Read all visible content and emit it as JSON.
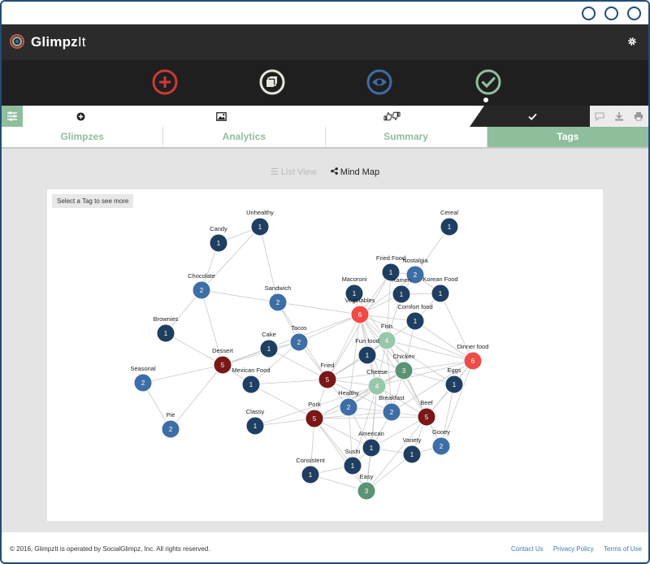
{
  "app": {
    "brand_bold": "Glimpz",
    "brand_rest": "It"
  },
  "toolbar": {
    "active_tool": "check"
  },
  "tabs": [
    {
      "label": "Glimpzes",
      "active": false
    },
    {
      "label": "Analytics",
      "active": false
    },
    {
      "label": "Summary",
      "active": false
    },
    {
      "label": "Tags",
      "active": true
    }
  ],
  "view_toggle": {
    "list_label": "List View",
    "mind_label": "Mind Map"
  },
  "hint": "Select a Tag to see more",
  "colors": {
    "navy": "#1e3f61",
    "blue": "#3d6ea6",
    "darkred": "#7a1717",
    "red": "#ef4b47",
    "mint": "#97c8aa",
    "green": "#5b9374"
  },
  "mind_map": {
    "nodes": [
      {
        "id": "unhealthy",
        "label": "Unhealthy",
        "count": "1",
        "color": "navy"
      },
      {
        "id": "candy",
        "label": "Candy",
        "count": "1",
        "color": "navy"
      },
      {
        "id": "chocolate",
        "label": "Chocolate",
        "count": "2",
        "color": "blue"
      },
      {
        "id": "sandwich",
        "label": "Sandwich",
        "count": "2",
        "color": "blue"
      },
      {
        "id": "brownies",
        "label": "Brownies",
        "count": "1",
        "color": "navy"
      },
      {
        "id": "cake",
        "label": "Cake",
        "count": "1",
        "color": "navy"
      },
      {
        "id": "tacos",
        "label": "Tacos",
        "count": "2",
        "color": "blue"
      },
      {
        "id": "dessert",
        "label": "Dessert",
        "count": "5",
        "color": "darkred"
      },
      {
        "id": "seasonal",
        "label": "Seasonal",
        "count": "2",
        "color": "blue"
      },
      {
        "id": "mexican",
        "label": "Mexican Food",
        "count": "1",
        "color": "navy"
      },
      {
        "id": "pie",
        "label": "Pie",
        "count": "2",
        "color": "blue"
      },
      {
        "id": "classy",
        "label": "Classy",
        "count": "1",
        "color": "navy"
      },
      {
        "id": "fried",
        "label": "Fried",
        "count": "5",
        "color": "darkred"
      },
      {
        "id": "pork",
        "label": "Pork",
        "count": "5",
        "color": "darkred"
      },
      {
        "id": "consistent",
        "label": "Consistent",
        "count": "1",
        "color": "navy"
      },
      {
        "id": "cereal",
        "label": "Cereal",
        "count": "1",
        "color": "navy"
      },
      {
        "id": "friedfood",
        "label": "Fried Food",
        "count": "1",
        "color": "navy"
      },
      {
        "id": "nostalgia",
        "label": "Nostalgia",
        "count": "2",
        "color": "blue"
      },
      {
        "id": "macoroni",
        "label": "Macoroni",
        "count": "1",
        "color": "navy"
      },
      {
        "id": "ramen",
        "label": "Ramen",
        "count": "1",
        "color": "navy"
      },
      {
        "id": "korean",
        "label": "Korean Food",
        "count": "1",
        "color": "navy"
      },
      {
        "id": "vegetables",
        "label": "Vegetables",
        "count": "6",
        "color": "red"
      },
      {
        "id": "comfort",
        "label": "Comfort food",
        "count": "1",
        "color": "navy"
      },
      {
        "id": "fish",
        "label": "Fish",
        "count": "4",
        "color": "mint"
      },
      {
        "id": "funfood",
        "label": "Fun food",
        "count": "1",
        "color": "navy"
      },
      {
        "id": "chicken",
        "label": "Chicken",
        "count": "3",
        "color": "green"
      },
      {
        "id": "dinner",
        "label": "Dinner food",
        "count": "6",
        "color": "red"
      },
      {
        "id": "eggs",
        "label": "Eggs",
        "count": "1",
        "color": "navy"
      },
      {
        "id": "cheese",
        "label": "Cheese",
        "count": "4",
        "color": "mint"
      },
      {
        "id": "healthy",
        "label": "Healthy",
        "count": "2",
        "color": "blue"
      },
      {
        "id": "breakfast",
        "label": "Breakfast",
        "count": "2",
        "color": "blue"
      },
      {
        "id": "beef",
        "label": "Beef",
        "count": "5",
        "color": "darkred"
      },
      {
        "id": "gooey",
        "label": "Gooey",
        "count": "2",
        "color": "blue"
      },
      {
        "id": "american",
        "label": "American",
        "count": "1",
        "color": "navy"
      },
      {
        "id": "variety",
        "label": "Variety",
        "count": "1",
        "color": "navy"
      },
      {
        "id": "sushi",
        "label": "Sushi",
        "count": "1",
        "color": "navy"
      },
      {
        "id": "easy",
        "label": "Easy",
        "count": "3",
        "color": "green"
      }
    ],
    "edges": [
      [
        "candy",
        "unhealthy"
      ],
      [
        "candy",
        "chocolate"
      ],
      [
        "unhealthy",
        "sandwich"
      ],
      [
        "unhealthy",
        "chocolate"
      ],
      [
        "chocolate",
        "brownies"
      ],
      [
        "chocolate",
        "dessert"
      ],
      [
        "chocolate",
        "sandwich"
      ],
      [
        "brownies",
        "dessert"
      ],
      [
        "dessert",
        "seasonal"
      ],
      [
        "dessert",
        "pie"
      ],
      [
        "dessert",
        "cake"
      ],
      [
        "dessert",
        "tacos"
      ],
      [
        "dessert",
        "mexican"
      ],
      [
        "dessert",
        "vegetables"
      ],
      [
        "seasonal",
        "pie"
      ],
      [
        "cake",
        "tacos"
      ],
      [
        "cake",
        "fried"
      ],
      [
        "sandwich",
        "tacos"
      ],
      [
        "sandwich",
        "vegetables"
      ],
      [
        "sandwich",
        "fried"
      ],
      [
        "tacos",
        "fried"
      ],
      [
        "tacos",
        "mexican"
      ],
      [
        "tacos",
        "vegetables"
      ],
      [
        "mexican",
        "fried"
      ],
      [
        "mexican",
        "pork"
      ],
      [
        "classy",
        "pork"
      ],
      [
        "classy",
        "cheese"
      ],
      [
        "fried",
        "pork"
      ],
      [
        "fried",
        "vegetables"
      ],
      [
        "fried",
        "fish"
      ],
      [
        "fried",
        "funfood"
      ],
      [
        "fried",
        "cheese"
      ],
      [
        "fried",
        "chicken"
      ],
      [
        "fried",
        "healthy"
      ],
      [
        "fried",
        "breakfast"
      ],
      [
        "fried",
        "friedfood"
      ],
      [
        "pork",
        "consistent"
      ],
      [
        "pork",
        "healthy"
      ],
      [
        "pork",
        "cheese"
      ],
      [
        "pork",
        "breakfast"
      ],
      [
        "pork",
        "beef"
      ],
      [
        "pork",
        "sushi"
      ],
      [
        "pork",
        "easy"
      ],
      [
        "pork",
        "american"
      ],
      [
        "pork",
        "chicken"
      ],
      [
        "consistent",
        "easy"
      ],
      [
        "consistent",
        "sushi"
      ],
      [
        "cereal",
        "nostalgia"
      ],
      [
        "friedfood",
        "vegetables"
      ],
      [
        "friedfood",
        "nostalgia"
      ],
      [
        "friedfood",
        "fish"
      ],
      [
        "nostalgia",
        "ramen"
      ],
      [
        "nostalgia",
        "vegetables"
      ],
      [
        "nostalgia",
        "korean"
      ],
      [
        "macoroni",
        "vegetables"
      ],
      [
        "macoroni",
        "fish"
      ],
      [
        "ramen",
        "korean"
      ],
      [
        "ramen",
        "vegetables"
      ],
      [
        "ramen",
        "fish"
      ],
      [
        "korean",
        "dinner"
      ],
      [
        "korean",
        "comfort"
      ],
      [
        "vegetables",
        "fish"
      ],
      [
        "vegetables",
        "funfood"
      ],
      [
        "vegetables",
        "cheese"
      ],
      [
        "vegetables",
        "chicken"
      ],
      [
        "vegetables",
        "comfort"
      ],
      [
        "vegetables",
        "dinner"
      ],
      [
        "vegetables",
        "healthy"
      ],
      [
        "vegetables",
        "beef"
      ],
      [
        "vegetables",
        "breakfast"
      ],
      [
        "comfort",
        "fish"
      ],
      [
        "comfort",
        "chicken"
      ],
      [
        "comfort",
        "dinner"
      ],
      [
        "fish",
        "funfood"
      ],
      [
        "fish",
        "chicken"
      ],
      [
        "fish",
        "dinner"
      ],
      [
        "fish",
        "cheese"
      ],
      [
        "fish",
        "beef"
      ],
      [
        "fish",
        "eggs"
      ],
      [
        "fish",
        "breakfast"
      ],
      [
        "funfood",
        "cheese"
      ],
      [
        "funfood",
        "chicken"
      ],
      [
        "chicken",
        "dinner"
      ],
      [
        "chicken",
        "eggs"
      ],
      [
        "chicken",
        "cheese"
      ],
      [
        "chicken",
        "beef"
      ],
      [
        "chicken",
        "breakfast"
      ],
      [
        "chicken",
        "healthy"
      ],
      [
        "chicken",
        "gooey"
      ],
      [
        "dinner",
        "eggs"
      ],
      [
        "dinner",
        "beef"
      ],
      [
        "dinner",
        "cheese"
      ],
      [
        "dinner",
        "breakfast"
      ],
      [
        "dinner",
        "gooey"
      ],
      [
        "eggs",
        "beef"
      ],
      [
        "eggs",
        "gooey"
      ],
      [
        "cheese",
        "healthy"
      ],
      [
        "cheese",
        "breakfast"
      ],
      [
        "cheese",
        "beef"
      ],
      [
        "cheese",
        "american"
      ],
      [
        "cheese",
        "easy"
      ],
      [
        "cheese",
        "sushi"
      ],
      [
        "healthy",
        "breakfast"
      ],
      [
        "healthy",
        "american"
      ],
      [
        "healthy",
        "sushi"
      ],
      [
        "breakfast",
        "beef"
      ],
      [
        "breakfast",
        "american"
      ],
      [
        "beef",
        "gooey"
      ],
      [
        "beef",
        "variety"
      ],
      [
        "beef",
        "american"
      ],
      [
        "beef",
        "easy"
      ],
      [
        "american",
        "sushi"
      ],
      [
        "american",
        "easy"
      ],
      [
        "american",
        "variety"
      ],
      [
        "variety",
        "easy"
      ],
      [
        "variety",
        "gooey"
      ],
      [
        "sushi",
        "easy"
      ]
    ]
  },
  "footer": {
    "copyright": "© 2016, GlimpzIt is operated by SocialGlimpz, Inc. All rights reserved.",
    "links": [
      "Contact Us",
      "Privacy Policy",
      "Terms of Use"
    ]
  }
}
